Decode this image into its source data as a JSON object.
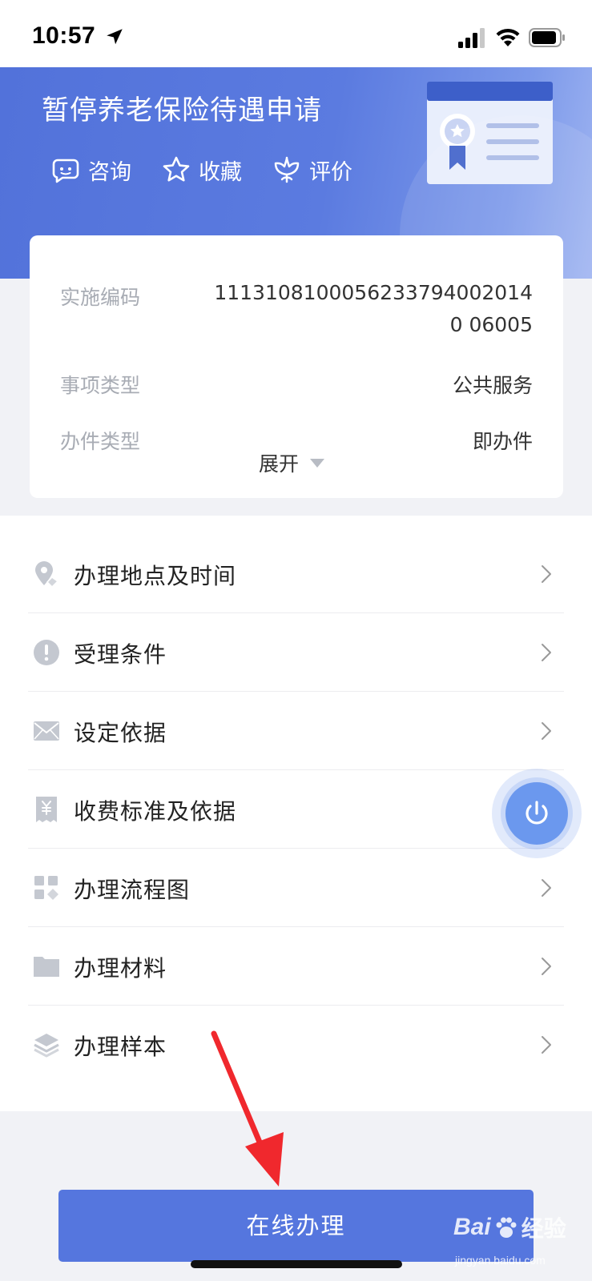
{
  "status_bar": {
    "time": "10:57"
  },
  "header": {
    "title": "暂停养老保险待遇申请",
    "actions": [
      {
        "label": "咨询",
        "icon": "chat-icon"
      },
      {
        "label": "收藏",
        "icon": "star-icon"
      },
      {
        "label": "评价",
        "icon": "flower-icon"
      }
    ]
  },
  "info": {
    "rows": [
      {
        "label": "实施编码",
        "value": "11131081000562337940020140 06005"
      },
      {
        "label": "事项类型",
        "value": "公共服务"
      },
      {
        "label": "办件类型",
        "value": "即办件"
      }
    ],
    "expand_label": "展开"
  },
  "menu": {
    "items": [
      {
        "label": "办理地点及时间",
        "icon": "location-icon"
      },
      {
        "label": "受理条件",
        "icon": "alert-icon"
      },
      {
        "label": "设定依据",
        "icon": "mail-icon"
      },
      {
        "label": "收费标准及依据",
        "icon": "fee-icon"
      },
      {
        "label": "办理流程图",
        "icon": "flowchart-icon"
      },
      {
        "label": "办理材料",
        "icon": "folder-icon"
      },
      {
        "label": "办理样本",
        "icon": "layers-icon"
      }
    ]
  },
  "footer": {
    "online_button": "在线办理"
  },
  "watermark": {
    "brand": "Bai",
    "suffix": "经验",
    "url": "jingyan.baidu.com"
  },
  "colors": {
    "primary": "#5576de",
    "header_gradient_start": "#5272da",
    "header_gradient_end": "#9fb4f1",
    "arrow": "#f0282d"
  }
}
